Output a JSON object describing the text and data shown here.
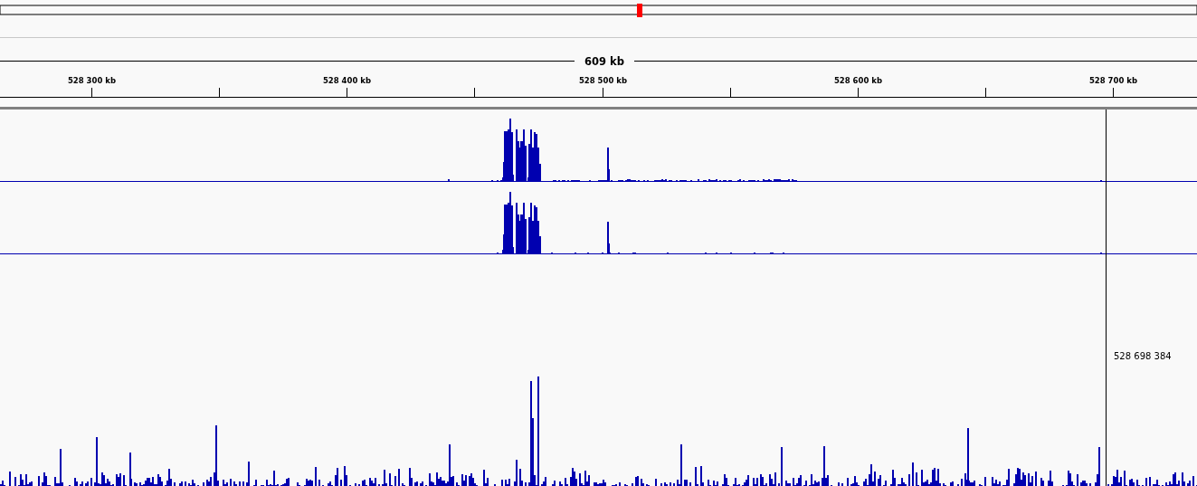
{
  "ideogram": {
    "kind": "chromosome"
  },
  "ruler": {
    "span_label": "609 kb",
    "ticks": [
      {
        "label": "528 300 kb"
      },
      {
        "label": "528 400 kb"
      },
      {
        "label": "528 500 kb"
      },
      {
        "label": "528 600 kb"
      },
      {
        "label": "528 700 kb"
      }
    ]
  },
  "tracks": [
    {
      "kind": "coverage"
    },
    {
      "kind": "coverage"
    },
    {
      "kind": "coverage"
    }
  ],
  "cursor": {
    "position_label": "528 698 384"
  }
}
